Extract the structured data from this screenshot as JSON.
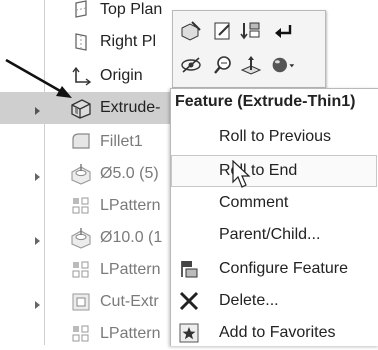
{
  "tree": {
    "items": [
      {
        "label": "Top Plan",
        "icon": "plane-icon"
      },
      {
        "label": "Right Pl",
        "icon": "plane-icon"
      },
      {
        "label": "Origin",
        "icon": "origin-icon"
      },
      {
        "label": "Extrude-",
        "icon": "extrude-thin-icon"
      },
      {
        "label": "Fillet1",
        "icon": "fillet-icon"
      },
      {
        "label": "Ø5.0 (5)",
        "icon": "hole-icon"
      },
      {
        "label": "LPattern",
        "icon": "linear-pattern-icon"
      },
      {
        "label": "Ø10.0 (1",
        "icon": "hole-icon"
      },
      {
        "label": "LPattern",
        "icon": "linear-pattern-icon"
      },
      {
        "label": "Cut-Extr",
        "icon": "cut-extrude-icon"
      },
      {
        "label": "LPattern",
        "icon": "linear-pattern-icon"
      }
    ]
  },
  "context_menu": {
    "title": "Feature (Extrude-Thin1)",
    "items": [
      {
        "label": "Roll to Previous",
        "icon": ""
      },
      {
        "label": "Roll to End",
        "icon": ""
      },
      {
        "label": "Comment",
        "icon": ""
      },
      {
        "label": "Parent/Child...",
        "icon": ""
      },
      {
        "label": "Configure Feature",
        "icon": "configure-feature-icon"
      },
      {
        "label": "Delete...",
        "icon": "delete-x-icon"
      },
      {
        "label": "Add to Favorites",
        "icon": "favorites-star-icon"
      }
    ]
  },
  "toolbar": {
    "icons": [
      "edit-feature-icon",
      "edit-sketch-icon",
      "rollback-icon",
      "parent-arrow-icon",
      "hide-icon",
      "zoom-to-selection-icon",
      "normal-to-icon",
      "appearance-icon"
    ]
  },
  "colors": {
    "selection_bg": "#cfcfcf",
    "menu_border": "#b9b9b9",
    "grey_text": "#7a7a7a"
  }
}
